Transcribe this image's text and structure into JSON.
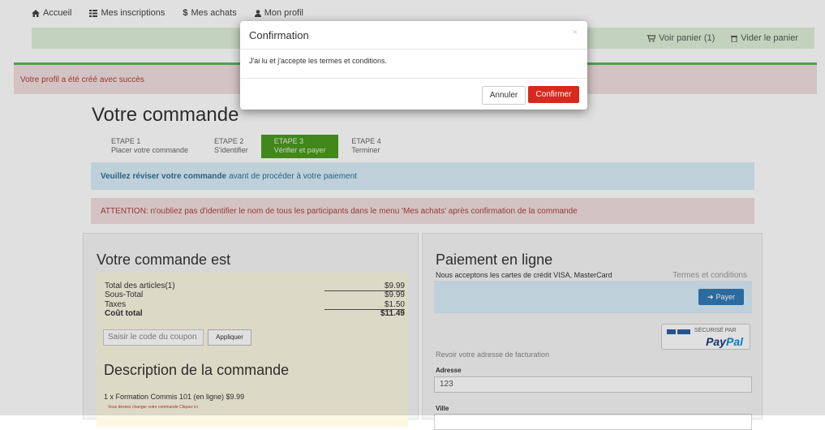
{
  "nav": {
    "items": [
      {
        "label": "Accueil",
        "icon": "home-icon"
      },
      {
        "label": "Mes inscriptions",
        "icon": "list-icon"
      },
      {
        "label": "Mes achats",
        "icon": "dollar-icon"
      },
      {
        "label": "Mon profil",
        "icon": "user-icon"
      }
    ],
    "cart_label": "Voir panier (1)",
    "empty_cart_label": "Vider le panier"
  },
  "alerts": {
    "success": "Votre profil a été créé avec succès",
    "info_bold": "Veuillez réviser votre commande",
    "info_rest": "avant de procéder à votre paiement",
    "warning": "ATTENTION: n'oubliez pas d'identifier le nom de tous les participants dans le menu 'Mes achats' après confirmation de la commande"
  },
  "order": {
    "title": "Votre commande",
    "steps": [
      {
        "name": "ETAPE 1",
        "desc": "Placer votre commande",
        "active": false
      },
      {
        "name": "ETAPE 2",
        "desc": "S'identifier",
        "active": false
      },
      {
        "name": "ETAPE 3",
        "desc": "Vérifier et payer",
        "active": true
      },
      {
        "name": "ETAPE 4",
        "desc": "Terminer",
        "active": false
      }
    ]
  },
  "summary": {
    "title": "Votre commande est",
    "rows": [
      {
        "label": "Total des articles(1)",
        "value": "$9.99"
      },
      {
        "label": "Sous-Total",
        "value": "$9.99"
      },
      {
        "label": "Taxes",
        "value": "$1.50"
      },
      {
        "label": "Coût total",
        "value": "$11.49"
      }
    ],
    "coupon_placeholder": "Saisir le code du coupon",
    "apply_label": "Appliquer",
    "description_title": "Description de la commande",
    "description_line": "1 x Formation Commis 101 (en ligne) $9.99",
    "description_note": "Vous désirez changer votre commande Cliquez ici"
  },
  "payment": {
    "title": "Paiement en ligne",
    "accept_text": "Nous acceptons les cartes de crédit VISA, MasterCard",
    "terms_label": "Termes et conditions",
    "pay_label": "Payer",
    "secure_label": "SÉCURISÉ PAR",
    "paypal_pay": "Pay",
    "paypal_pal": "Pal",
    "billing_text": "Revoir votre adresse de facturation",
    "address_label": "Adresse",
    "address_value": "123",
    "city_label": "Ville"
  },
  "modal": {
    "title": "Confirmation",
    "close": "×",
    "body": "J'ai lu et j'accepte les termes et conditions.",
    "cancel_label": "Annuler",
    "confirm_label": "Confirmer"
  },
  "colors": {
    "confirm": "#d9291c",
    "step_active": "#4b9a1d",
    "pay_button": "#337ab7"
  }
}
